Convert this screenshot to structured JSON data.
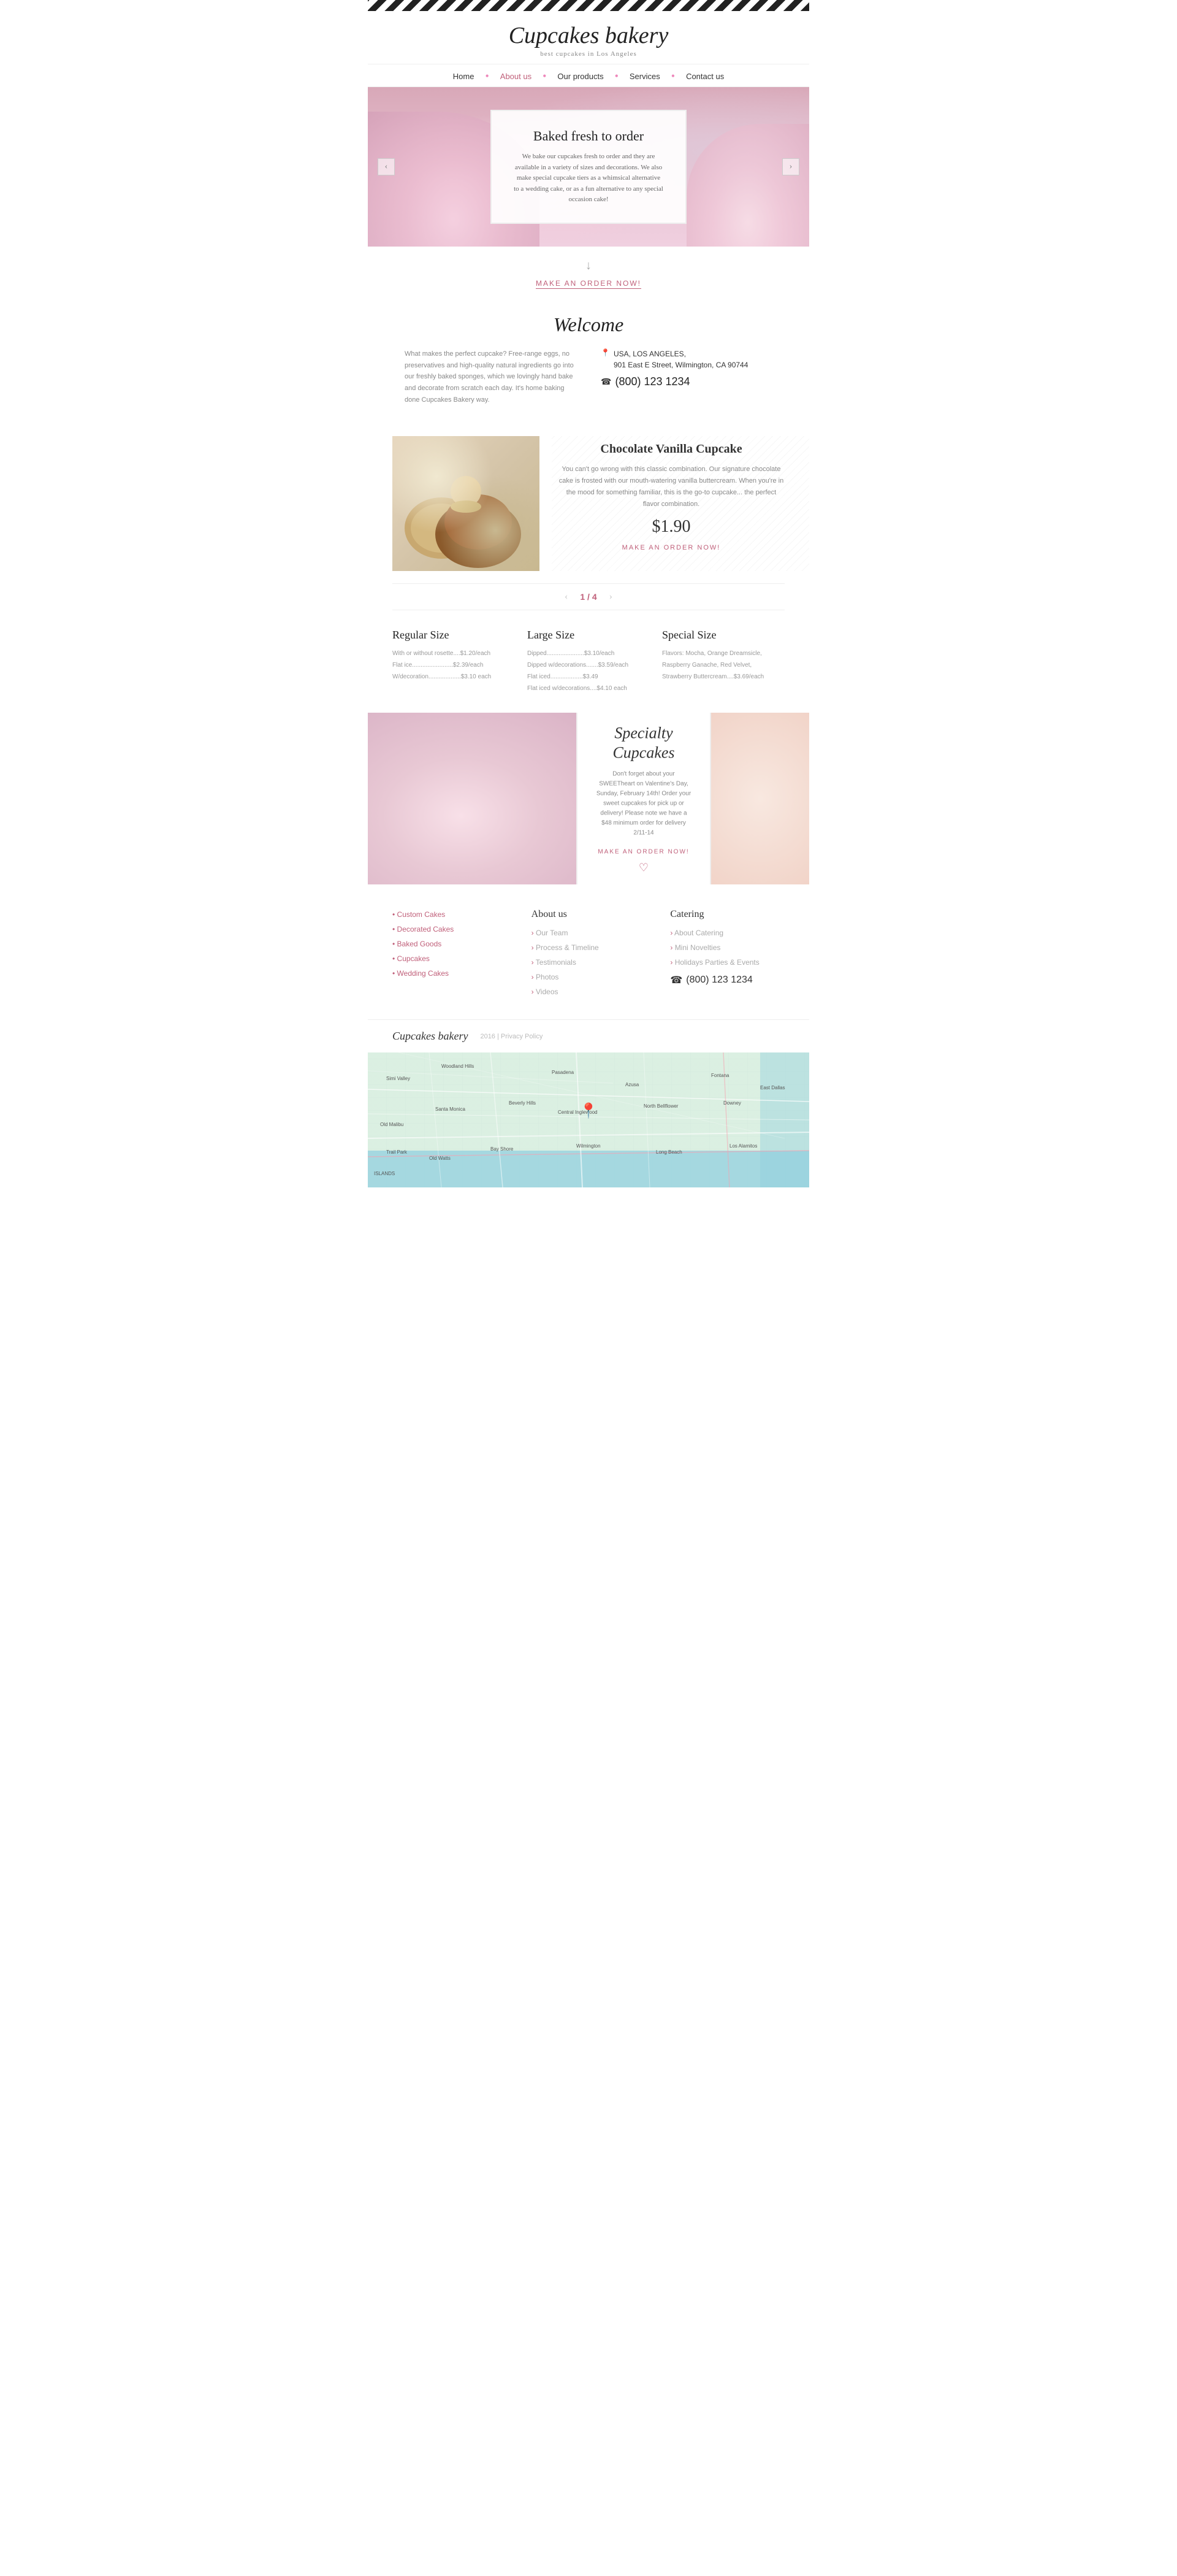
{
  "site": {
    "title": "Cupcakes bakery",
    "tagline": "best cupcakes in Los Angeles"
  },
  "nav": {
    "items": [
      {
        "label": "Home",
        "active": false
      },
      {
        "label": "About us",
        "active": true
      },
      {
        "label": "Our products",
        "active": false
      },
      {
        "label": "Services",
        "active": false
      },
      {
        "label": "Contact us",
        "active": false
      }
    ]
  },
  "hero": {
    "title": "Baked fresh to order",
    "description": "We bake our cupcakes fresh to order and they are available in a variety of sizes and decorations. We also make special cupcake tiers as a whimsical alternative to a wedding cake, or as a fun alternative to any special occasion cake!",
    "prev_label": "‹",
    "next_label": "›"
  },
  "cta": {
    "label": "MAKE AN ORDER NOW!"
  },
  "welcome": {
    "title": "Welcome",
    "text": "What makes the perfect cupcake? Free-range eggs, no preservatives and high-quality natural ingredients go into our freshly baked sponges, which we lovingly hand bake and decorate from scratch each day. It's home baking done Cupcakes Bakery way.",
    "address_line1": "USA, LOS ANGELES,",
    "address_line2": "901 East E Street, Wilmington, CA 90744",
    "phone": "(800) 123 1234"
  },
  "product": {
    "name": "Chocolate Vanilla Cupcake",
    "description": "You can't go wrong with this classic combination. Our signature chocolate cake is frosted with our mouth-watering vanilla buttercream. When you're in the mood for something familiar, this is the go-to cupcake... the perfect flavor combination.",
    "price": "$1.90",
    "order_label": "MAKE AN ORDER NOW!",
    "counter_current": "1",
    "counter_total": "4"
  },
  "sizes": {
    "regular": {
      "title": "Regular Size",
      "items": "With or without rosette....$1.20/each\nFlat ice........................$2.39/each\nW/decoration...................$3.10 each"
    },
    "large": {
      "title": "Large Size",
      "items": "Dipped......................$3.10/each\nDipped w/decorations.......$3.59/each\nFlat iced...................$3.49\nFlat iced w/decorations....$4.10 each"
    },
    "special": {
      "title": "Special Size",
      "items": "Flavors: Mocha, Orange Dreamsicle,\nRaspberry Ganache, Red Velvet,\nStrawberry Buttercream....$3.69/each"
    }
  },
  "specialty": {
    "title": "Specialty\nCupcakes",
    "description": "Don't forget about your SWEETheart on Valentine's Day, Sunday, February 14th! Order your sweet cupcakes for pick up or delivery! Please note we have a $48 minimum order for delivery 2/11-14",
    "order_label": "MAKE AN ORDER NOW!"
  },
  "footer": {
    "col1_title": "",
    "col1_links": [
      {
        "label": "Custom Cakes"
      },
      {
        "label": "Decorated Cakes"
      },
      {
        "label": "Baked Goods"
      },
      {
        "label": "Cupcakes"
      },
      {
        "label": "Wedding Cakes"
      }
    ],
    "col2_title": "About us",
    "col2_links": [
      {
        "label": "Our Team"
      },
      {
        "label": "Process & Timeline"
      },
      {
        "label": "Testimonials"
      },
      {
        "label": "Photos"
      },
      {
        "label": "Videos"
      }
    ],
    "col3_title": "Catering",
    "col3_links": [
      {
        "label": "About Catering"
      },
      {
        "label": "Mini Novelties"
      },
      {
        "label": "Holidays Parties & Events"
      }
    ],
    "phone": "(800) 123 1234",
    "brand": "Cupcakes bakery",
    "copy": "2016 | Privacy Policy"
  }
}
